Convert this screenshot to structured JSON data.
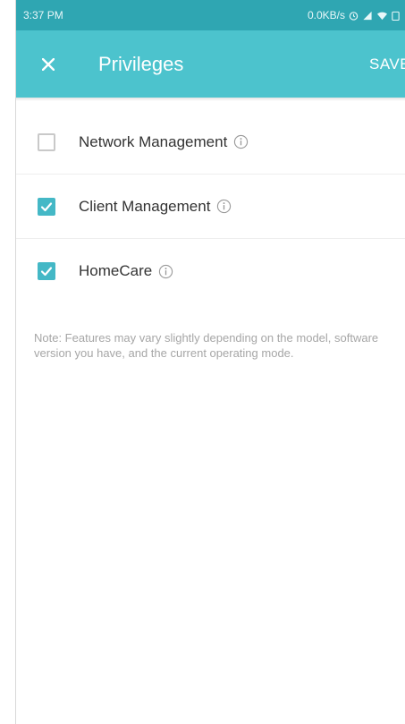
{
  "status_bar": {
    "time": "3:37 PM",
    "speed": "0.0KB/s"
  },
  "app_bar": {
    "title": "Privileges",
    "save_label": "SAVE"
  },
  "privileges": [
    {
      "label": "Network Management",
      "checked": false
    },
    {
      "label": "Client Management",
      "checked": true
    },
    {
      "label": "HomeCare",
      "checked": true
    }
  ],
  "note": "Note: Features may vary slightly depending on the model, software version you have, and the current operating mode.",
  "colors": {
    "status_bar": "#2fa6b2",
    "app_bar": "#4cc3cd",
    "checkbox_checked": "#44b8c6"
  },
  "icons": {
    "close": "close-icon",
    "info": "info-icon",
    "check": "check-icon"
  }
}
